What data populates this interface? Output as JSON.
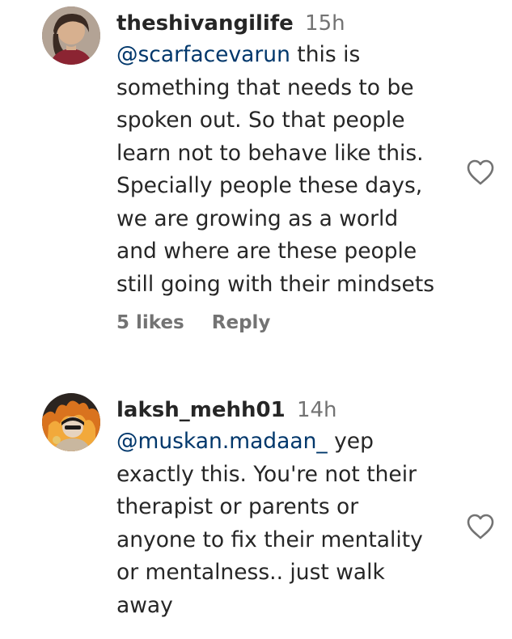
{
  "comments": [
    {
      "username": "theshivangilife",
      "time": "15h",
      "mention": "@scarfacevarun",
      "first_line_rest": " this is",
      "lines": [
        "something that needs to be",
        "spoken out. So that people",
        "learn not to behave like this.",
        "Specially people these days,",
        "we are growing as a world",
        "and where are these people",
        "still going with their mindsets"
      ],
      "likes": "5 likes",
      "reply": "Reply",
      "like_icon": "heart-outline-icon"
    },
    {
      "username": "laksh_mehh01",
      "time": "14h",
      "mention": "@muskan.madaan_",
      "first_line_rest": " yep",
      "lines": [
        "exactly this. You're not their",
        "therapist or parents or",
        "anyone to fix their mentality",
        "or mentalness.. just walk",
        "away"
      ],
      "like_icon": "heart-outline-icon"
    }
  ],
  "colors": {
    "text": "#262626",
    "secondary": "#737373",
    "mention": "#00376b"
  }
}
